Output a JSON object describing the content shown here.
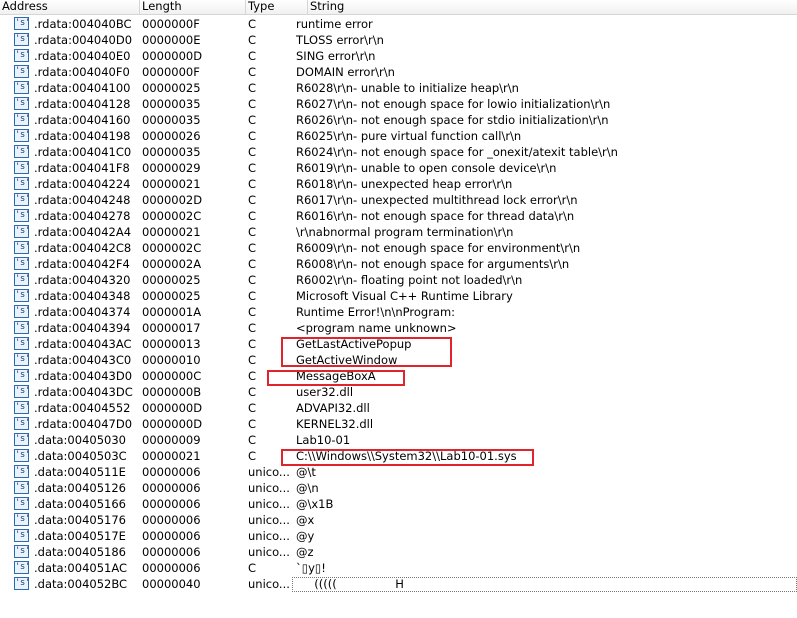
{
  "columns": {
    "address": "Address",
    "length": "Length",
    "type": "Type",
    "string": "String"
  },
  "icon": {
    "name": "string-icon",
    "glyph": "'s'"
  },
  "highlight_color": "#e0242b",
  "rows": [
    {
      "address": ".rdata:004040BC",
      "length": "0000000F",
      "type": "C",
      "string": "runtime error"
    },
    {
      "address": ".rdata:004040D0",
      "length": "0000000E",
      "type": "C",
      "string": "TLOSS error\\r\\n"
    },
    {
      "address": ".rdata:004040E0",
      "length": "0000000D",
      "type": "C",
      "string": "SING error\\r\\n"
    },
    {
      "address": ".rdata:004040F0",
      "length": "0000000F",
      "type": "C",
      "string": "DOMAIN error\\r\\n"
    },
    {
      "address": ".rdata:00404100",
      "length": "00000025",
      "type": "C",
      "string": "R6028\\r\\n- unable to initialize heap\\r\\n"
    },
    {
      "address": ".rdata:00404128",
      "length": "00000035",
      "type": "C",
      "string": "R6027\\r\\n- not enough space for lowio initialization\\r\\n"
    },
    {
      "address": ".rdata:00404160",
      "length": "00000035",
      "type": "C",
      "string": "R6026\\r\\n- not enough space for stdio initialization\\r\\n"
    },
    {
      "address": ".rdata:00404198",
      "length": "00000026",
      "type": "C",
      "string": "R6025\\r\\n- pure virtual function call\\r\\n"
    },
    {
      "address": ".rdata:004041C0",
      "length": "00000035",
      "type": "C",
      "string": "R6024\\r\\n- not enough space for _onexit/atexit table\\r\\n"
    },
    {
      "address": ".rdata:004041F8",
      "length": "00000029",
      "type": "C",
      "string": "R6019\\r\\n- unable to open console device\\r\\n"
    },
    {
      "address": ".rdata:00404224",
      "length": "00000021",
      "type": "C",
      "string": "R6018\\r\\n- unexpected heap error\\r\\n"
    },
    {
      "address": ".rdata:00404248",
      "length": "0000002D",
      "type": "C",
      "string": "R6017\\r\\n- unexpected multithread lock error\\r\\n"
    },
    {
      "address": ".rdata:00404278",
      "length": "0000002C",
      "type": "C",
      "string": "R6016\\r\\n- not enough space for thread data\\r\\n"
    },
    {
      "address": ".rdata:004042A4",
      "length": "00000021",
      "type": "C",
      "string": "\\r\\nabnormal program termination\\r\\n"
    },
    {
      "address": ".rdata:004042C8",
      "length": "0000002C",
      "type": "C",
      "string": "R6009\\r\\n- not enough space for environment\\r\\n"
    },
    {
      "address": ".rdata:004042F4",
      "length": "0000002A",
      "type": "C",
      "string": "R6008\\r\\n- not enough space for arguments\\r\\n"
    },
    {
      "address": ".rdata:00404320",
      "length": "00000025",
      "type": "C",
      "string": "R6002\\r\\n- floating point not loaded\\r\\n"
    },
    {
      "address": ".rdata:00404348",
      "length": "00000025",
      "type": "C",
      "string": "Microsoft Visual C++ Runtime Library"
    },
    {
      "address": ".rdata:00404374",
      "length": "0000001A",
      "type": "C",
      "string": "Runtime Error!\\n\\nProgram: "
    },
    {
      "address": ".rdata:00404394",
      "length": "00000017",
      "type": "C",
      "string": "<program name unknown>"
    },
    {
      "address": ".rdata:004043AC",
      "length": "00000013",
      "type": "C",
      "string": "GetLastActivePopup"
    },
    {
      "address": ".rdata:004043C0",
      "length": "00000010",
      "type": "C",
      "string": "GetActiveWindow"
    },
    {
      "address": ".rdata:004043D0",
      "length": "0000000C",
      "type": "C",
      "string": "MessageBoxA"
    },
    {
      "address": ".rdata:004043DC",
      "length": "0000000B",
      "type": "C",
      "string": "user32.dll"
    },
    {
      "address": ".rdata:00404552",
      "length": "0000000D",
      "type": "C",
      "string": "ADVAPI32.dll"
    },
    {
      "address": ".rdata:004047D0",
      "length": "0000000D",
      "type": "C",
      "string": "KERNEL32.dll"
    },
    {
      "address": ".data:00405030",
      "length": "00000009",
      "type": "C",
      "string": "Lab10-01"
    },
    {
      "address": ".data:0040503C",
      "length": "00000021",
      "type": "C",
      "string": "C:\\\\Windows\\\\System32\\\\Lab10-01.sys"
    },
    {
      "address": ".data:0040511E",
      "length": "00000006",
      "type": "unico...",
      "string": "@\\t"
    },
    {
      "address": ".data:00405126",
      "length": "00000006",
      "type": "unico...",
      "string": "@\\n"
    },
    {
      "address": ".data:00405166",
      "length": "00000006",
      "type": "unico...",
      "string": "@\\x1B"
    },
    {
      "address": ".data:00405176",
      "length": "00000006",
      "type": "unico...",
      "string": "@x"
    },
    {
      "address": ".data:0040517E",
      "length": "00000006",
      "type": "unico...",
      "string": "@y"
    },
    {
      "address": ".data:00405186",
      "length": "00000006",
      "type": "unico...",
      "string": "@z"
    },
    {
      "address": ".data:004051AC",
      "length": "00000006",
      "type": "C",
      "string": "`▯y▯!"
    },
    {
      "address": ".data:004052BC",
      "length": "00000040",
      "type": "unico...",
      "string": "     (((((                H"
    }
  ]
}
